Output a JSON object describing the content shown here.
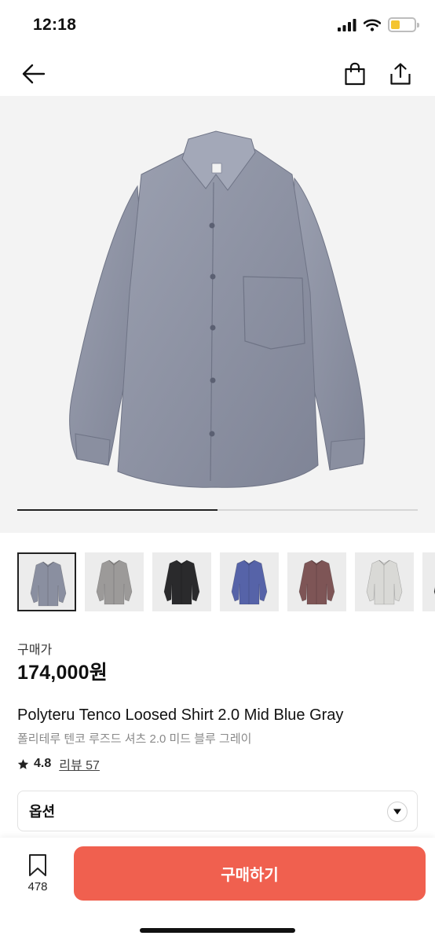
{
  "status_bar": {
    "time": "12:18",
    "battery_color": "#f4c430"
  },
  "nav": {
    "back_icon": "arrow-left-icon",
    "bag_icon": "shopping-bag-icon",
    "share_icon": "share-icon"
  },
  "hero": {
    "carousel_progress": 0.5
  },
  "thumbnails": [
    {
      "color": "#8a8fa0",
      "selected": true
    },
    {
      "color": "#9c9a99",
      "selected": false
    },
    {
      "color": "#2a2a2c",
      "selected": false
    },
    {
      "color": "#5663a8",
      "selected": false
    },
    {
      "color": "#7e5556",
      "selected": false
    },
    {
      "color": "#d9d9d6",
      "selected": false
    },
    {
      "color": "#2f2f30",
      "selected": false
    }
  ],
  "price": {
    "label": "구매가",
    "value": "174,000원"
  },
  "product": {
    "name_en": "Polyteru Tenco Loosed Shirt 2.0 Mid Blue Gray",
    "name_ko": "폴리테루 텐코 루즈드 셔츠 2.0 미드 블루 그레이"
  },
  "rating": {
    "value": "4.8",
    "review_label": "리뷰 57"
  },
  "options": {
    "label": "옵션"
  },
  "bottom": {
    "wish_count": "478",
    "buy_label": "구매하기",
    "buy_color": "#f0604f"
  }
}
